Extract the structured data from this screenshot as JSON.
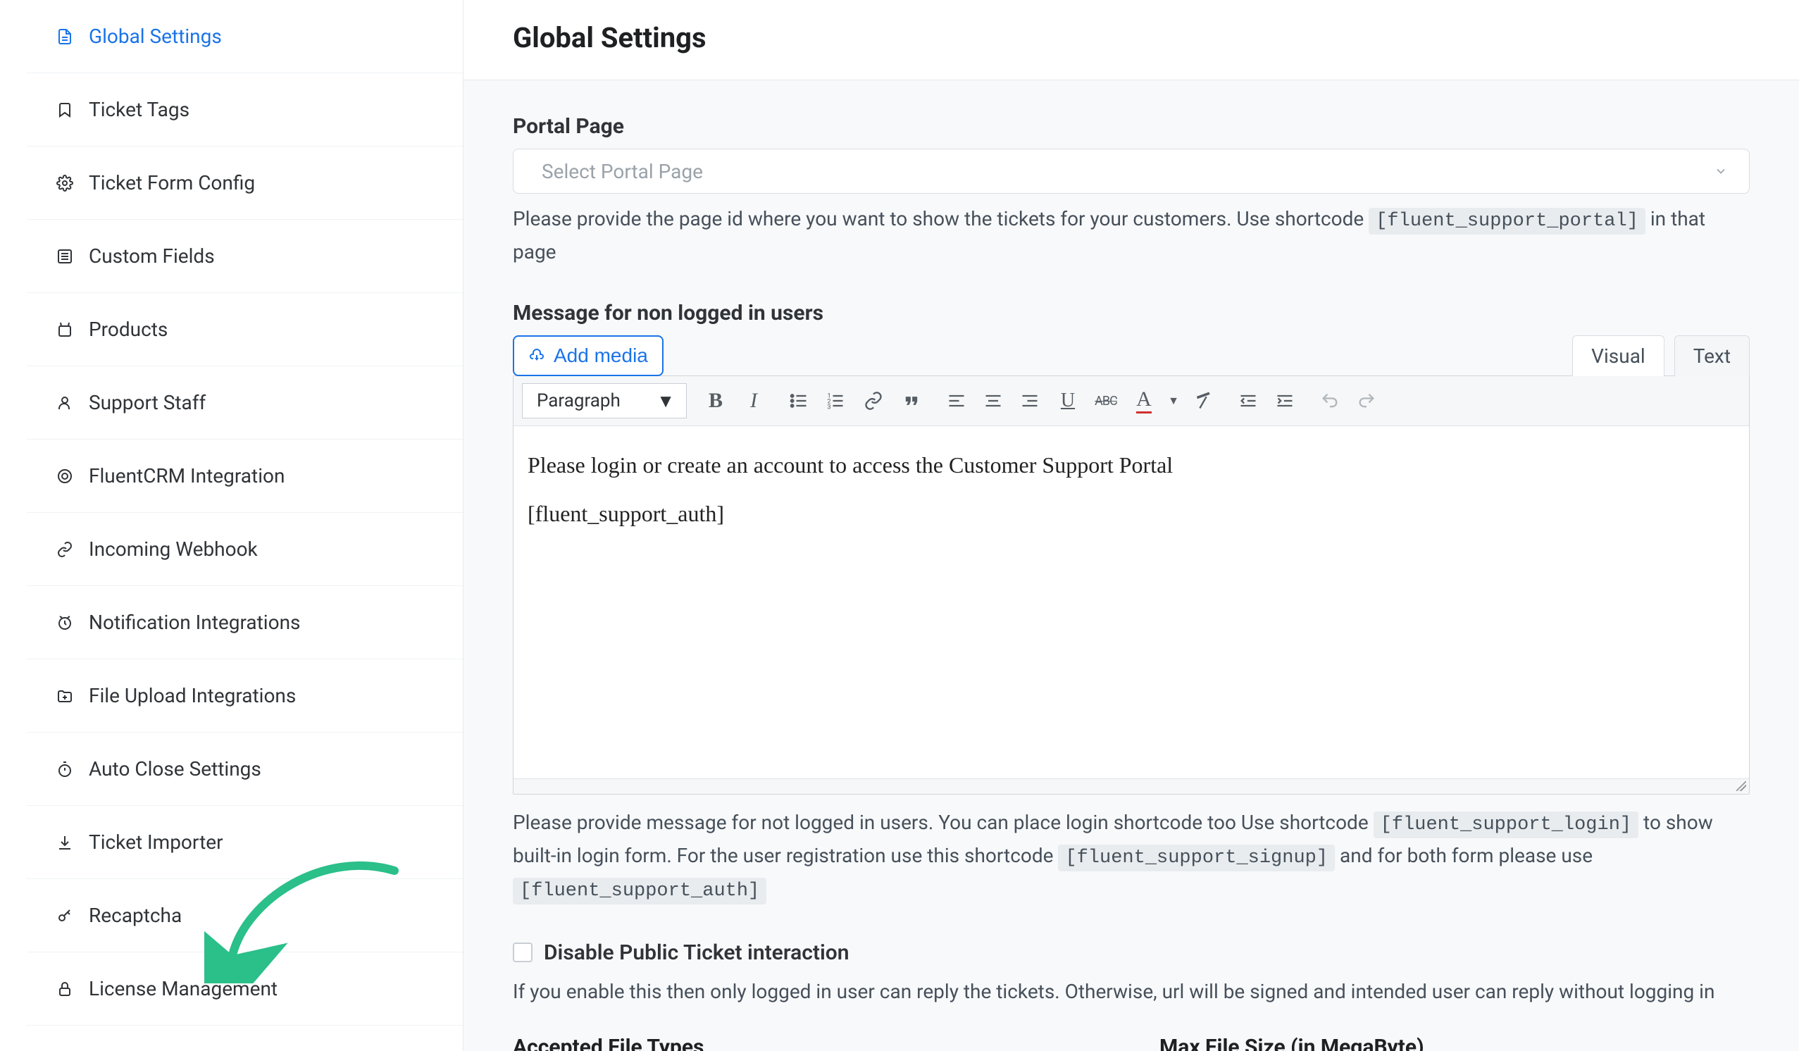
{
  "sidebar": {
    "items": [
      {
        "label": "Global Settings"
      },
      {
        "label": "Ticket Tags"
      },
      {
        "label": "Ticket Form Config"
      },
      {
        "label": "Custom Fields"
      },
      {
        "label": "Products"
      },
      {
        "label": "Support Staff"
      },
      {
        "label": "FluentCRM Integration"
      },
      {
        "label": "Incoming Webhook"
      },
      {
        "label": "Notification Integrations"
      },
      {
        "label": "File Upload Integrations"
      },
      {
        "label": "Auto Close Settings"
      },
      {
        "label": "Ticket Importer"
      },
      {
        "label": "Recaptcha"
      },
      {
        "label": "License Management"
      }
    ]
  },
  "page": {
    "title": "Global Settings"
  },
  "portal": {
    "label": "Portal Page",
    "placeholder": "Select Portal Page",
    "hint_pre": "Please provide the page id where you want to show the tickets for your customers. Use shortcode ",
    "code": "[fluent_support_portal]",
    "hint_post": " in that page"
  },
  "editor": {
    "label": "Message for non logged in users",
    "add_media": "Add media",
    "tab_visual": "Visual",
    "tab_text": "Text",
    "paragraph_label": "Paragraph",
    "body_line1": "Please login or create an account to access the Customer Support Portal",
    "body_line2": "[fluent_support_auth]",
    "hint1_pre": "Please provide message for not logged in users. You can place login shortcode too Use shortcode ",
    "code_login": "[fluent_support_login]",
    "hint1_mid": " to show built-in login form. For the user registration use this shortcode ",
    "code_signup": "[fluent_support_signup]",
    "hint1_mid2": " and for both form please use ",
    "code_auth": "[fluent_support_auth]"
  },
  "disable_public": {
    "label": "Disable Public Ticket interaction",
    "hint": "If you enable this then only logged in user can reply the tickets. Otherwise, url will be signed and intended user can reply without logging in"
  },
  "accepted_label": "Accepted File Types",
  "maxsize_label": "Max File Size (in MegaByte)"
}
